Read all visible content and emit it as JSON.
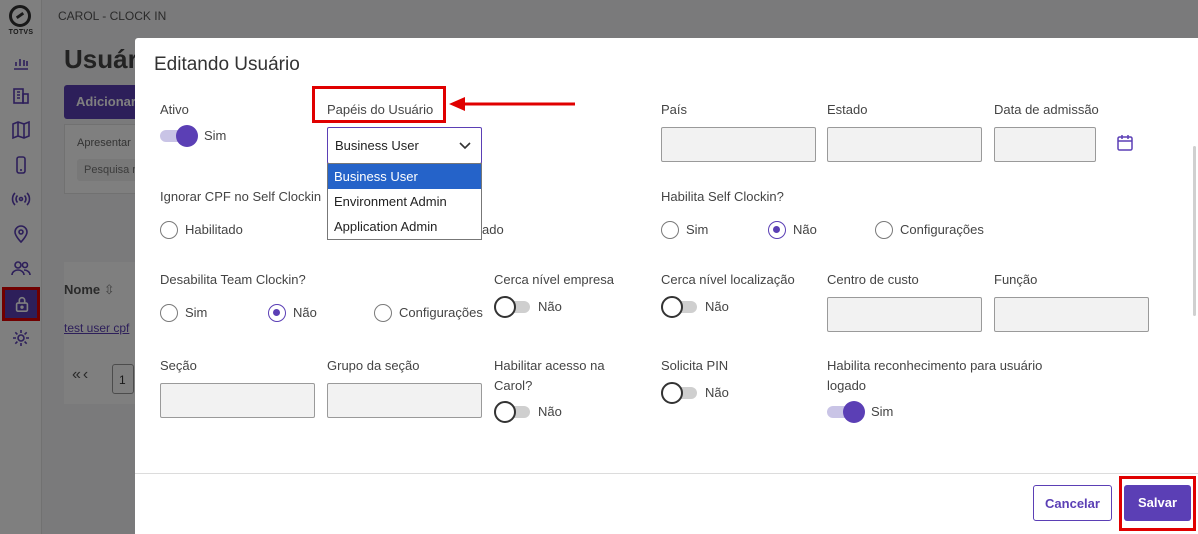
{
  "app": {
    "logo_text": "TOTVS",
    "breadcrumb": "CAROL - CLOCK IN",
    "page_title": "Usuár",
    "add_button": "Adicionar",
    "card_text": "Apresentar",
    "search_placeholder": "Pesquisa r",
    "table_header_name": "Nome",
    "row_link": "test user cpf",
    "pager_arrows": "«‹",
    "pager_page": "1"
  },
  "sidebar": {
    "icons": [
      "chart-icon",
      "building-icon",
      "map-icon",
      "phone-icon",
      "signal-icon",
      "location-pin-icon",
      "users-icon",
      "lock-icon",
      "gear-icon"
    ],
    "active": "lock-icon"
  },
  "modal": {
    "title": "Editando Usuário",
    "fields": {
      "ativo": {
        "label": "Ativo",
        "state_text": "Sim",
        "on": true
      },
      "papeis": {
        "label": "Papéis do Usuário",
        "value": "Business User",
        "options": [
          "Business User",
          "Environment Admin",
          "Application Admin"
        ],
        "selected_index": 0
      },
      "pais": {
        "label": "País",
        "value": ""
      },
      "estado": {
        "label": "Estado",
        "value": ""
      },
      "data_admissao": {
        "label": "Data de admissão",
        "value": ""
      },
      "ignorar_cpf": {
        "label": "Ignorar CPF no Self Clockin",
        "option_habilitado": "Habilitado",
        "partial_option": "ado"
      },
      "self_clockin": {
        "label": "Habilita Self Clockin?",
        "options": [
          "Sim",
          "Não",
          "Configurações"
        ],
        "selected": "Não"
      },
      "team_clockin": {
        "label": "Desabilita Team Clockin?",
        "options": [
          "Sim",
          "Não",
          "Configurações"
        ],
        "selected": "Não"
      },
      "cerca_empresa": {
        "label": "Cerca nível empresa",
        "state_text": "Não",
        "on": false
      },
      "cerca_localizacao": {
        "label": "Cerca nível localização",
        "state_text": "Não",
        "on": false
      },
      "centro_custo": {
        "label": "Centro de custo",
        "value": ""
      },
      "funcao": {
        "label": "Função",
        "value": ""
      },
      "secao": {
        "label": "Seção",
        "value": ""
      },
      "grupo_secao": {
        "label": "Grupo da seção",
        "value": ""
      },
      "acesso_carol": {
        "label_line1": "Habilitar acesso na",
        "label_line2": "Carol?",
        "state_text": "Não",
        "on": false
      },
      "solicita_pin": {
        "label": "Solicita PIN",
        "state_text": "Não",
        "on": false
      },
      "reconhecimento": {
        "label_line1": "Habilita reconhecimento para usuário",
        "label_line2": "logado",
        "state_text": "Sim",
        "on": true
      }
    },
    "buttons": {
      "cancel": "Cancelar",
      "save": "Salvar"
    }
  },
  "colors": {
    "primary": "#5b3fb5",
    "annotation_red": "#e00000",
    "option_highlight": "#2563c9"
  }
}
